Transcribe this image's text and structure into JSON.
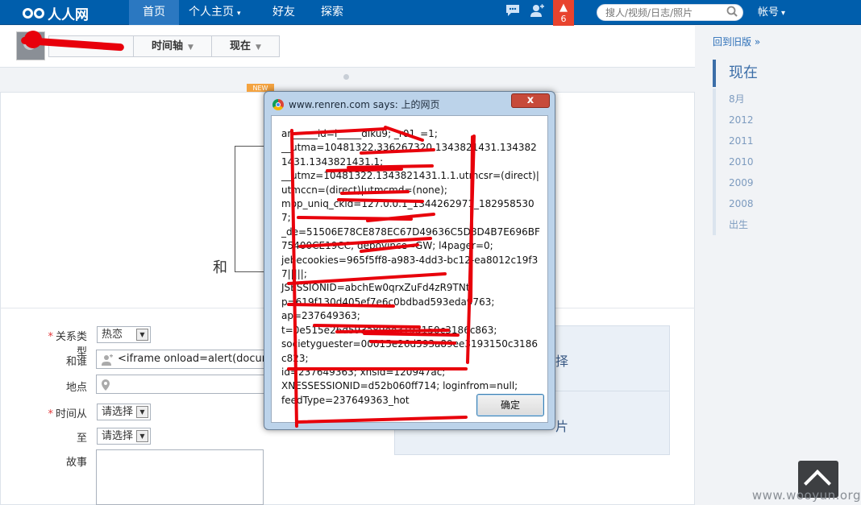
{
  "nav": {
    "brand": "人人网",
    "items": [
      {
        "label": "首页"
      },
      {
        "label": "个人主页",
        "has_caret": true
      },
      {
        "label": "好友"
      },
      {
        "label": "探索"
      }
    ],
    "notification_count": "6",
    "search_placeholder": "搜人/视频/日志/照片",
    "account_label": "帐号",
    "caret": "▾"
  },
  "profile": {
    "tabs": [
      {
        "label": "时间轴"
      },
      {
        "label": "现在"
      }
    ],
    "tab_arrow": "▼"
  },
  "content": {
    "new_badge": "NEW",
    "life_event_word": "和"
  },
  "form": {
    "relation_label": "关系类型",
    "relation_value": "热恋",
    "with_label": "和谁",
    "with_value": "<iframe onload=alert(document.c",
    "place_label": "地点",
    "time_from_label": "时间从",
    "time_from_value": "请选择",
    "time_to_label": "至",
    "time_to_value": "请选择",
    "story_label": "故事",
    "required_mark": "*"
  },
  "panel": {
    "text_top": "择",
    "text_bottom": "片"
  },
  "sidebar": {
    "back_link": "回到旧版 »",
    "timeline": [
      {
        "label": "现在",
        "active": true
      },
      {
        "label": "8月"
      },
      {
        "label": "2012"
      },
      {
        "label": "2011"
      },
      {
        "label": "2010"
      },
      {
        "label": "2009"
      },
      {
        "label": "2008"
      },
      {
        "label": "出生"
      }
    ]
  },
  "dialog": {
    "title": "www.renren.com says: 上的网页",
    "close_glyph": "x",
    "message": "an_____id=l_____dlku9; _r01_=1;\n__utma=10481322.336267320.1343821431.1343821431.1343821431.1;\n__utmz=10481322.1343821431.1.1.utmcsr=(direct)|utmccn=(direct)|utmcmd=(none);\nmop_uniq_ckid=127.0.0.1_1344262971_1829585307;\n_de=51506E78CE878EC67D49636C5D8D4B7E696BF75400CE19CC; depovince=GW; l4pager=0;\njebecookies=965f5ff8-a983-4dd3-bc12-ea8012c19f37|||||;\nJSESSIONID=abchEw0qrxZuFd4zR9TNt;\np=619f130d405ef7e6c0bdbad593eda9763;\nap=237649363;\nt=0e515e26d593a89ee3193150c3186c863;\nsocietyguester=00015e26d593a89ee3193150c3186c823;\nid=237649363; xnsid=120947ac;\nXNESSESSIONID=d52b060ff714; loginfrom=null;\nfeedType=237649363_hot",
    "ok_label": "确定"
  },
  "watermark": "www.wooyun.org",
  "colors": {
    "nav_bg": "#005eac",
    "badge_red": "#e8432e",
    "redaction_red": "#e8000b",
    "link_blue": "#2c6fb8"
  }
}
